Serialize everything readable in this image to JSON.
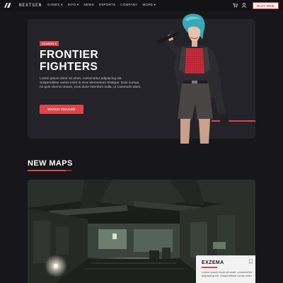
{
  "nav": {
    "brand": "NEXTGEN",
    "menu": [
      {
        "label": "GAMES ▾"
      },
      {
        "label": "INFO ▾"
      },
      {
        "label": "NEWS"
      },
      {
        "label": "ESPORTS"
      },
      {
        "label": "COMPANY"
      },
      {
        "label": "MORE ▾"
      }
    ],
    "play_label": "PLAY NOW",
    "icons": [
      "logo-icon",
      "cart-icon",
      "user-icon"
    ]
  },
  "hero": {
    "badge": "SEASON 5",
    "title_line1": "FRONTIER",
    "title_line2": "FIGHTERS",
    "description": "Lorem ipsum dolor sit amet, consectetur adipiscing elit. Suspendisse varius enim in eros elementum tristique. Duis cursus, mi quis viverra ornare, eros dolor interdum nulla, ut commodo diam.",
    "cta_label": "WATCH TRAILER"
  },
  "maps_section": {
    "title": "NEW MAPS",
    "card": {
      "name": "EXZEMA",
      "description": "Lorem ipsum dolor sit amet, consectetur adipiscing elit. Suspendisse varius enim"
    }
  },
  "colors": {
    "accent": "#e2434b",
    "background": "#17171b",
    "panel": "#232329",
    "card_light": "#f2f2f2"
  }
}
